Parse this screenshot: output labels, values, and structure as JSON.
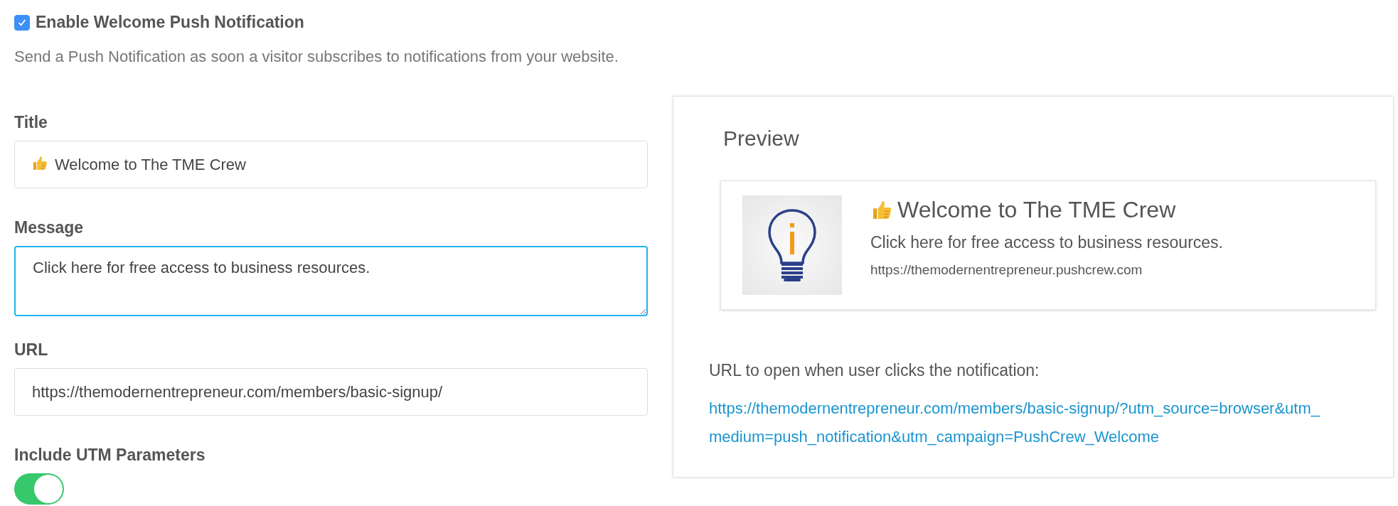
{
  "enable": {
    "label": "Enable Welcome Push Notification",
    "checked": true
  },
  "description": "Send a Push Notification as soon a visitor subscribes to notifications from your website.",
  "form": {
    "title": {
      "label": "Title",
      "value": "Welcome to The TME Crew"
    },
    "message": {
      "label": "Message",
      "value": "Click here for free access to business resources.",
      "focused": true
    },
    "url": {
      "label": "URL",
      "value": "https://themodernentrepreneur.com/members/basic-signup/"
    },
    "utm": {
      "label": "Include UTM Parameters",
      "on": true
    }
  },
  "preview": {
    "heading": "Preview",
    "notification": {
      "title": "Welcome to The TME Crew",
      "message": "Click here for free access to business resources.",
      "domain": "https://themodernentrepreneur.pushcrew.com"
    },
    "url_label": "URL to open when user clicks the notification:",
    "url_link": "https://themodernentrepreneur.com/members/basic-signup/?utm_source=browser&utm_medium=push_notification&utm_campaign=PushCrew_Welcome"
  }
}
